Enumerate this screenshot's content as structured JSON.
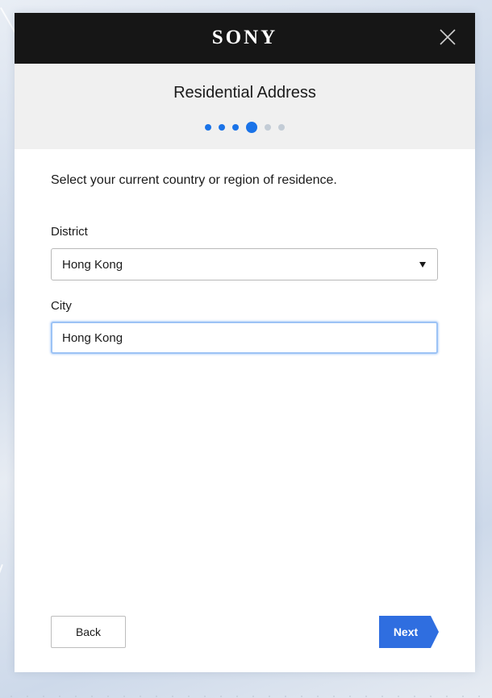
{
  "brand": {
    "logo_text": "SONY"
  },
  "header": {
    "title": "Residential Address",
    "steps": {
      "total": 6,
      "current": 4
    }
  },
  "form": {
    "instruction": "Select your current country or region of residence.",
    "district": {
      "label": "District",
      "value": "Hong Kong"
    },
    "city": {
      "label": "City",
      "value": "Hong Kong"
    }
  },
  "footer": {
    "back_label": "Back",
    "next_label": "Next"
  },
  "colors": {
    "topbar": "#161616",
    "accent": "#1a73e8",
    "next_button": "#2f6ee0",
    "step_pending": "#c3ccd6"
  },
  "icons": {
    "close": "close-icon",
    "caret": "caret-down-icon"
  }
}
